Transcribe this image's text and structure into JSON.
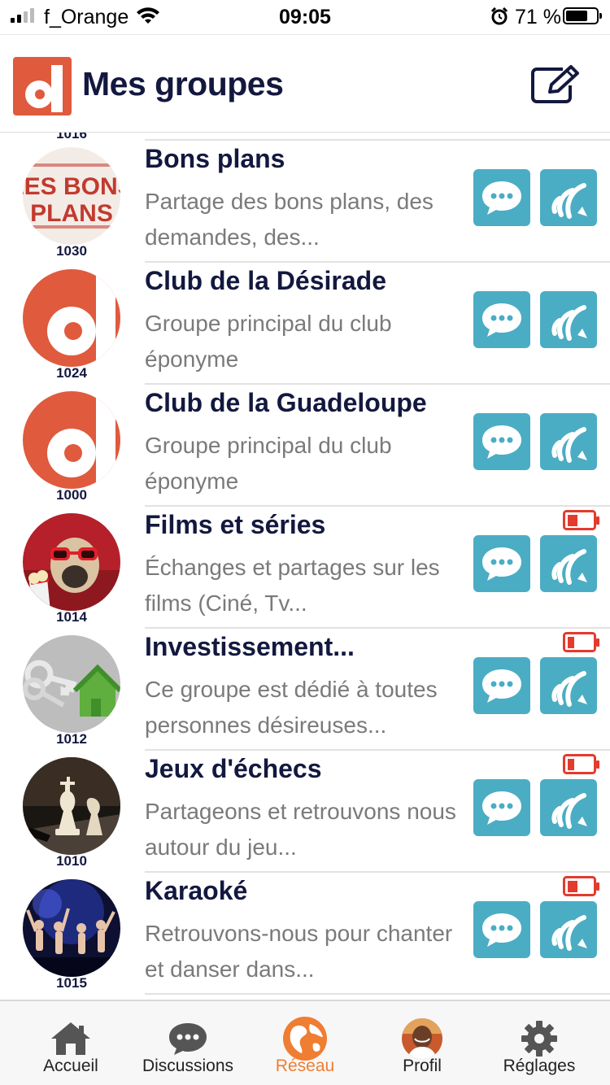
{
  "status_bar": {
    "carrier": "f_Orange",
    "time": "09:05",
    "battery_percent": "71 %"
  },
  "header": {
    "title": "Mes groupes"
  },
  "peek_id": "1016",
  "groups": [
    {
      "name": "Bons plans",
      "desc": "Partage des bons plans, des demandes, des...",
      "id": "1030",
      "avatar": "les-bons-plans",
      "low_battery": false
    },
    {
      "name": "Club de la Désirade",
      "desc": "Groupe principal du club éponyme",
      "id": "1024",
      "avatar": "d-logo",
      "low_battery": false
    },
    {
      "name": "Club de la Guadeloupe",
      "desc": "Groupe principal du club éponyme",
      "id": "1000",
      "avatar": "d-logo",
      "low_battery": false
    },
    {
      "name": "Films et séries",
      "desc": "Échanges et partages sur les films (Ciné, Tv...",
      "id": "1014",
      "avatar": "pug-cinema",
      "low_battery": true
    },
    {
      "name": "Investissement...",
      "desc": "Ce groupe est dédié à toutes personnes désireuses...",
      "id": "1012",
      "avatar": "keys-house",
      "low_battery": true
    },
    {
      "name": "Jeux d'échecs",
      "desc": "Partageons et retrouvons nous autour du jeu...",
      "id": "1010",
      "avatar": "chess",
      "low_battery": true
    },
    {
      "name": "Karaoké",
      "desc": "Retrouvons-nous pour chanter et danser dans...",
      "id": "1015",
      "avatar": "concert",
      "low_battery": true
    }
  ],
  "tabs": [
    {
      "label": "Accueil",
      "icon": "home-icon",
      "active": false
    },
    {
      "label": "Discussions",
      "icon": "chat-bubble-icon",
      "active": false
    },
    {
      "label": "Réseau",
      "icon": "globe-icon",
      "active": true
    },
    {
      "label": "Profil",
      "icon": "profile-avatar",
      "active": false
    },
    {
      "label": "Réglages",
      "icon": "gear-icon",
      "active": false
    }
  ],
  "colors": {
    "brand_red": "#e05a3d",
    "navy": "#13183f",
    "action_teal": "#4aadc4",
    "active_tab_orange": "#ef7d32",
    "low_battery_red": "#e33b2e"
  }
}
